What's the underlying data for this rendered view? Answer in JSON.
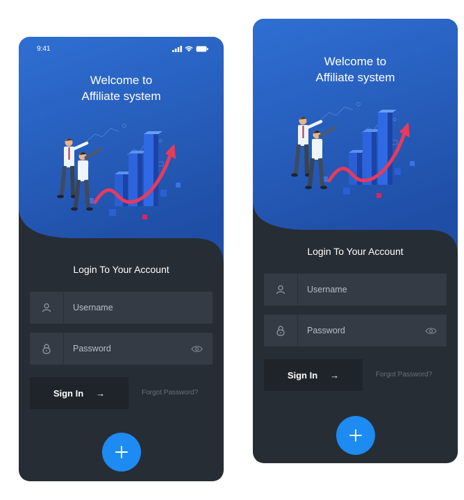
{
  "screens": [
    {
      "status_time": "9:41",
      "welcome_line1": "Welcome to",
      "welcome_line2": "Affiliate system",
      "login_title": "Login To Your Account",
      "username_placeholder": "Username",
      "password_placeholder": "Password",
      "signin_label": "Sign In",
      "signin_arrow": "→",
      "forgot_label": "Forgot Password?",
      "fab_symbol": "+"
    },
    {
      "welcome_line1": "Welcome to",
      "welcome_line2": "Affiliate system",
      "login_title": "Login To Your Account",
      "username_placeholder": "Username",
      "password_placeholder": "Password",
      "signin_label": "Sign In",
      "signin_arrow": "→",
      "forgot_label": "Forgot Password?",
      "fab_symbol": "+"
    }
  ],
  "colors": {
    "hero_blue": "#2f6fd3",
    "hero_blue_dark": "#1f4ea6",
    "panel_dark": "#272d35",
    "field_bg": "#343b44",
    "button_dark": "#1f242b",
    "fab_blue": "#1d8bf2"
  },
  "icons": [
    "signal-icon",
    "wifi-icon",
    "battery-icon",
    "user-icon",
    "lock-icon",
    "eye-icon",
    "arrow-right-icon",
    "plus-icon"
  ]
}
